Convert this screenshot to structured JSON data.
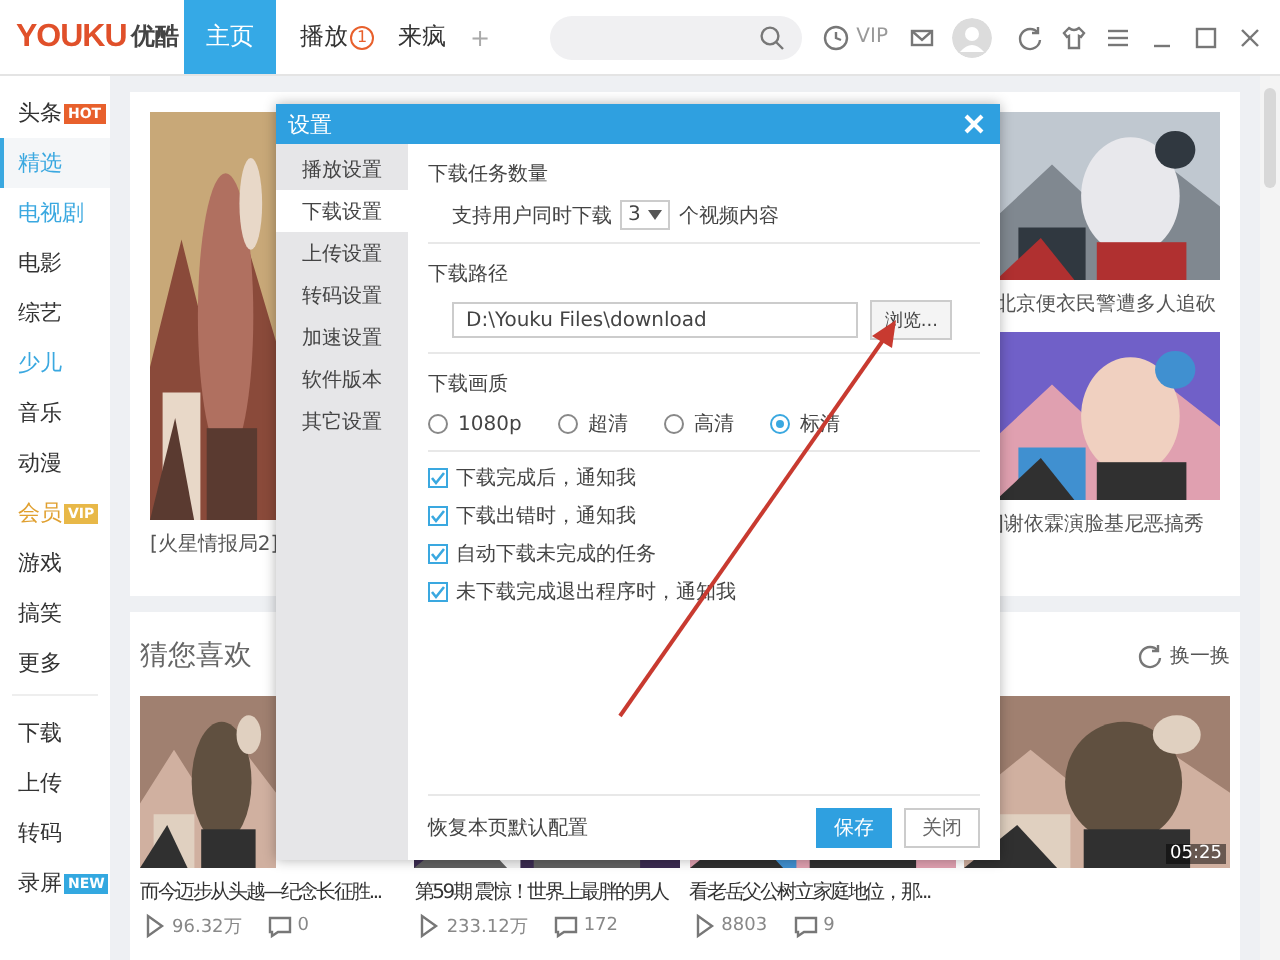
{
  "app": {
    "logo": {
      "latin": "YOUKU",
      "chinese": "优酷"
    },
    "tabs": [
      {
        "label": "主页",
        "selected": true
      },
      {
        "label": "播放",
        "selected": false,
        "badge": "1"
      },
      {
        "label": "来疯",
        "selected": false
      },
      {
        "label": "+",
        "selected": false
      }
    ],
    "vip": "VIP"
  },
  "sidebar": {
    "items": [
      {
        "label": "头条",
        "selected": false,
        "color": "#333333",
        "tag": {
          "text": "HOT",
          "color": "#e8602c"
        }
      },
      {
        "label": "精选",
        "selected": true,
        "color": "#3aa8e0"
      },
      {
        "label": "电视剧",
        "selected": false,
        "color": "#3aa8e0"
      },
      {
        "label": "电影",
        "selected": false,
        "color": "#333333"
      },
      {
        "label": "综艺",
        "selected": false,
        "color": "#333333"
      },
      {
        "label": "少儿",
        "selected": false,
        "color": "#3aa8e0"
      },
      {
        "label": "音乐",
        "selected": false,
        "color": "#333333"
      },
      {
        "label": "动漫",
        "selected": false,
        "color": "#333333"
      },
      {
        "label": "会员",
        "selected": false,
        "color": "#e0a030",
        "tag": {
          "text": "VIP",
          "color": "#e8b848"
        }
      },
      {
        "label": "游戏",
        "selected": false,
        "color": "#333333"
      },
      {
        "label": "搞笑",
        "selected": false,
        "color": "#333333"
      },
      {
        "label": "更多",
        "selected": false,
        "color": "#333333"
      }
    ],
    "tools": [
      {
        "label": "下载"
      },
      {
        "label": "上传"
      },
      {
        "label": "转码"
      },
      {
        "label": "录屏",
        "tag": {
          "text": "NEW",
          "color": "#33a8e0"
        }
      }
    ]
  },
  "featured": {
    "main_caption": "[火星情报局2]",
    "side_captions": [
      "北京便衣民警遭多人追砍",
      "]谢依霖演脸基尼恶搞秀"
    ]
  },
  "recommend": {
    "title": "猜您喜欢",
    "refresh": "换一换",
    "videos": [
      {
        "title": "而今迈步从头越—纪念长征胜...",
        "plays": "96.32万",
        "comments": "0"
      },
      {
        "title": "第59期 震惊！世界上最胖的男人",
        "plays": "233.12万",
        "comments": "172"
      },
      {
        "title": "看老岳父公树立家庭地位，那...",
        "plays": "8803",
        "comments": "9"
      },
      {
        "duration": "05:25"
      }
    ]
  },
  "dialog": {
    "title": "设置",
    "nav": [
      {
        "label": "播放设置",
        "selected": false
      },
      {
        "label": "下载设置",
        "selected": true
      },
      {
        "label": "上传设置",
        "selected": false
      },
      {
        "label": "转码设置",
        "selected": false
      },
      {
        "label": "加速设置",
        "selected": false
      },
      {
        "label": "软件版本",
        "selected": false
      },
      {
        "label": "其它设置",
        "selected": false
      }
    ],
    "task_count": {
      "heading": "下载任务数量",
      "prefix": "支持用户同时下载",
      "value": "3",
      "suffix": "个视频内容"
    },
    "path": {
      "heading": "下载路径",
      "value": "D:\\Youku Files\\download",
      "browse": "浏览..."
    },
    "quality": {
      "heading": "下载画质",
      "options": [
        {
          "label": "1080p",
          "selected": false
        },
        {
          "label": "超清",
          "selected": false
        },
        {
          "label": "高清",
          "selected": false
        },
        {
          "label": "标清",
          "selected": true
        }
      ]
    },
    "notifications": [
      {
        "label": "下载完成后，通知我",
        "checked": true
      },
      {
        "label": "下载出错时，通知我",
        "checked": true
      },
      {
        "label": "自动下载未完成的任务",
        "checked": true
      },
      {
        "label": "未下载完成退出程序时，通知我",
        "checked": true
      }
    ],
    "reset": "恢复本页默认配置",
    "buttons": [
      {
        "label": "保存",
        "kind": "primary"
      },
      {
        "label": "关闭",
        "kind": "secondary"
      }
    ]
  }
}
